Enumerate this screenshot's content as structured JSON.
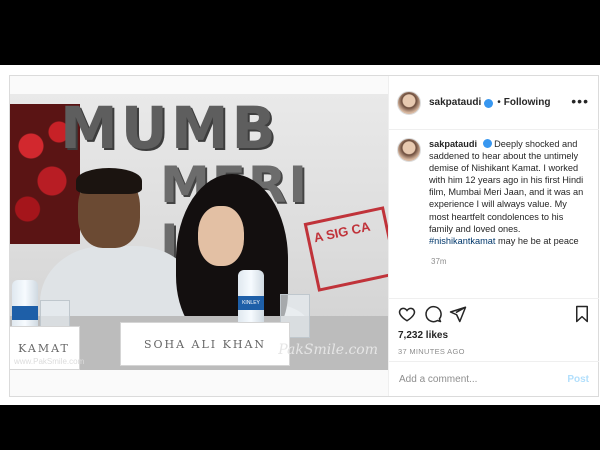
{
  "header": {
    "username": "sakpataudi",
    "separator": "•",
    "follow_status": "Following",
    "more": "•••"
  },
  "caption": {
    "username": "sakpataudi",
    "text": "Deeply shocked and saddened to hear about the untimely demise of Nishikant Kamat. I worked with him 12 years ago in his first Hindi film, Mumbai Meri Jaan, and it was an experience I will always value. My most heartfelt condolences to his family and loved ones.",
    "hashtag": "#nishikantkamat",
    "text_after": " may he be at peace",
    "time": "37m"
  },
  "photo": {
    "poster_title": "MUMB",
    "poster_title2": "MERI JAA",
    "stamp": "A SIG CA",
    "nameplate_left": "KAMAT",
    "nameplate_right": "SOHA ALI KHAN",
    "watermark_left": "www.PakSmile.com",
    "watermark_right": "PakSmile.com",
    "bottle_label": "KINLEY"
  },
  "engagement": {
    "likes": "7,232 likes",
    "posted": "37 MINUTES AGO"
  },
  "comment": {
    "placeholder": "Add a comment...",
    "post_label": "Post"
  },
  "icons": [
    "heart-icon",
    "comment-icon",
    "share-icon",
    "bookmark-icon",
    "verified-icon",
    "more-icon"
  ],
  "colors": {
    "verified": "#3897f0",
    "hashtag": "#00376b",
    "post_button": "#b2dffc"
  }
}
